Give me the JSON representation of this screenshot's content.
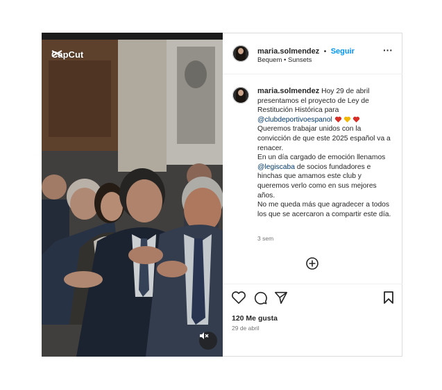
{
  "media": {
    "watermark": "CapCut",
    "mute_icon": "speaker-muted-icon"
  },
  "header": {
    "username": "maria.solmendez",
    "separator": "•",
    "follow_label": "Seguir",
    "audio_artist": "Bequem",
    "audio_sep": "•",
    "audio_track": "Sunsets",
    "more_label": "···"
  },
  "caption": {
    "username": "maria.solmendez",
    "text_1": "Hoy 29 de abril presentamos el proyecto de Ley de Restitución Histórica para",
    "mention_1": "@clubdeportivoespanol",
    "line_2": "Queremos trabajar unidos con la convicción de que este 2025 español va a renacer.",
    "line_3a": "En un día cargado de emoción llenamos",
    "mention_2": "@legiscaba",
    "line_3b": "de socios fundadores e hinchas que amamos este club y queremos verlo como en sus mejores años.",
    "line_4": "No me queda más que agradecer a todos los que se acercaron a compartir este día.",
    "time_ago": "3 sem",
    "hearts": [
      "#d62f27",
      "#f2b705",
      "#d62f27"
    ]
  },
  "actions": {
    "likes": "120 Me gusta",
    "date": "29 de abril"
  },
  "colors": {
    "link": "#0095f6",
    "mention": "#00376b"
  }
}
